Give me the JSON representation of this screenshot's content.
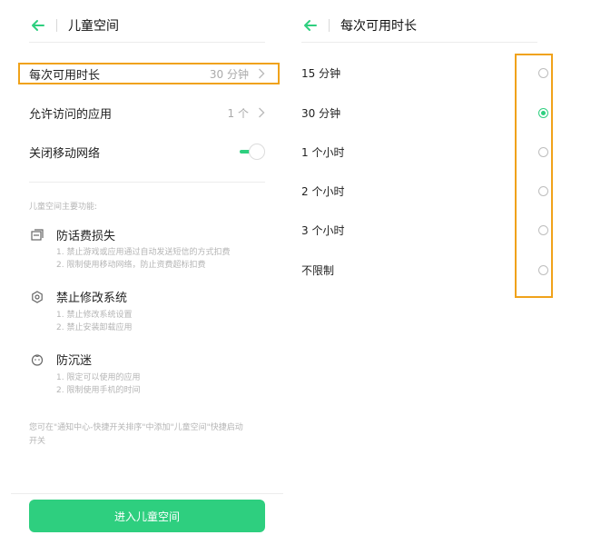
{
  "colors": {
    "accent": "#2ecf7f",
    "highlight": "#f0a21a"
  },
  "left": {
    "title": "儿童空间",
    "settings": {
      "duration_label": "每次可用时长",
      "duration_value": "30 分钟",
      "apps_label": "允许访问的应用",
      "apps_value": "1 个",
      "network_label": "关闭移动网络",
      "network_on": true
    },
    "features_heading": "儿童空间主要功能:",
    "features": [
      {
        "icon": "card-icon",
        "title": "防话费损失",
        "lines": [
          "1. 禁止游戏或应用通过自动发送短信的方式扣费",
          "2. 限制使用移动网络，防止资费超标扣费"
        ]
      },
      {
        "icon": "settings-ring-icon",
        "title": "禁止修改系统",
        "lines": [
          "1. 禁止修改系统设置",
          "2. 禁止安装卸载应用"
        ]
      },
      {
        "icon": "child-face-icon",
        "title": "防沉迷",
        "lines": [
          "1. 限定可以使用的应用",
          "2. 限制使用手机的时间"
        ]
      }
    ],
    "footer_note_1": "您可在\"通知中心-快捷开关排序\"中添加\"儿童空间\"快捷启动",
    "footer_note_2": "开关",
    "enter_button": "进入儿童空间"
  },
  "right": {
    "title": "每次可用时长",
    "options": [
      {
        "label": "15 分钟",
        "selected": false
      },
      {
        "label": "30 分钟",
        "selected": true
      },
      {
        "label": "1 个小时",
        "selected": false
      },
      {
        "label": "2 个小时",
        "selected": false
      },
      {
        "label": "3 个小时",
        "selected": false
      },
      {
        "label": "不限制",
        "selected": false
      }
    ]
  }
}
